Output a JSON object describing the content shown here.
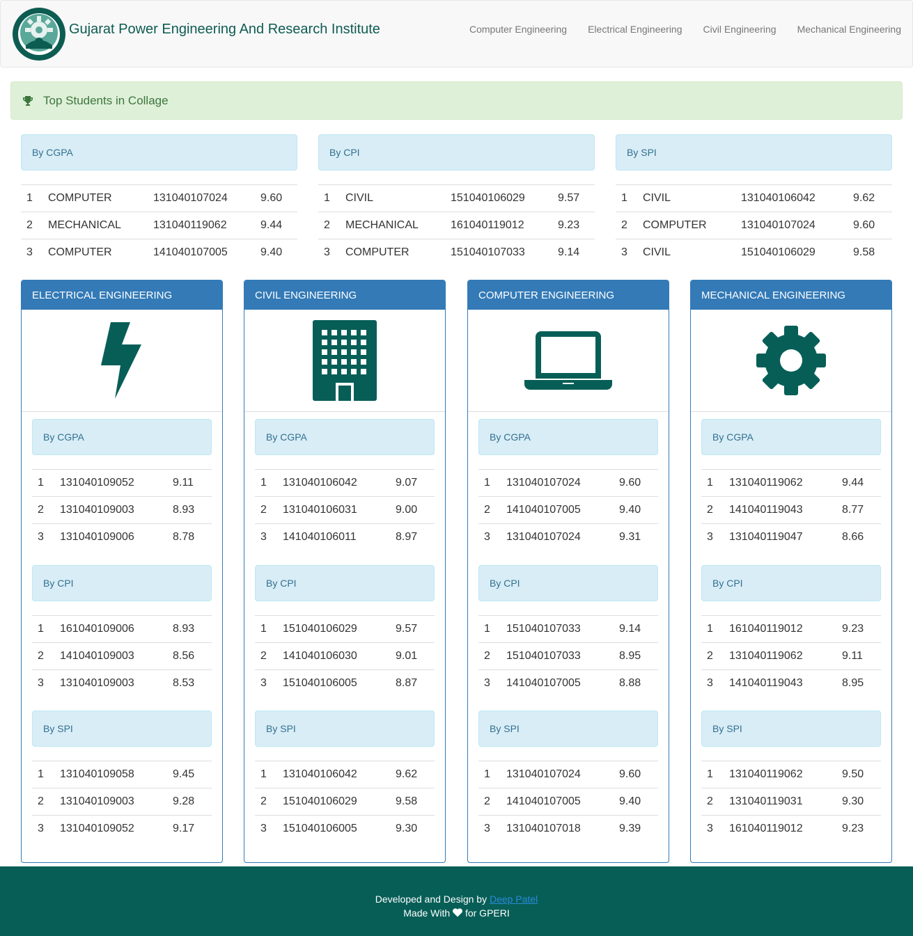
{
  "navbar": {
    "brand": "Gujarat Power Engineering And Research Institute",
    "links": [
      "Computer Engineering",
      "Electrical Engineering",
      "Civil Engineering",
      "Mechanical Engineering"
    ]
  },
  "alert": {
    "text": "Top Students in Collage",
    "icon": "trophy-icon"
  },
  "top": [
    {
      "heading": "By CGPA",
      "rows": [
        [
          "1",
          "COMPUTER",
          "131040107024",
          "9.60"
        ],
        [
          "2",
          "MECHANICAL",
          "131040119062",
          "9.44"
        ],
        [
          "3",
          "COMPUTER",
          "141040107005",
          "9.40"
        ]
      ]
    },
    {
      "heading": "By CPI",
      "rows": [
        [
          "1",
          "CIVIL",
          "151040106029",
          "9.57"
        ],
        [
          "2",
          "MECHANICAL",
          "161040119012",
          "9.23"
        ],
        [
          "3",
          "COMPUTER",
          "151040107033",
          "9.14"
        ]
      ]
    },
    {
      "heading": "By SPI",
      "rows": [
        [
          "1",
          "CIVIL",
          "131040106042",
          "9.62"
        ],
        [
          "2",
          "COMPUTER",
          "131040107024",
          "9.60"
        ],
        [
          "3",
          "CIVIL",
          "151040106029",
          "9.58"
        ]
      ]
    }
  ],
  "departments": [
    {
      "title": "ELECTRICAL ENGINEERING",
      "icon": "bolt-icon",
      "sections": [
        {
          "heading": "By CGPA",
          "rows": [
            [
              "1",
              "131040109052",
              "9.11"
            ],
            [
              "2",
              "131040109003",
              "8.93"
            ],
            [
              "3",
              "131040109006",
              "8.78"
            ]
          ]
        },
        {
          "heading": "By CPI",
          "rows": [
            [
              "1",
              "161040109006",
              "8.93"
            ],
            [
              "2",
              "141040109003",
              "8.56"
            ],
            [
              "3",
              "131040109003",
              "8.53"
            ]
          ]
        },
        {
          "heading": "By SPI",
          "rows": [
            [
              "1",
              "131040109058",
              "9.45"
            ],
            [
              "2",
              "131040109003",
              "9.28"
            ],
            [
              "3",
              "131040109052",
              "9.17"
            ]
          ]
        }
      ]
    },
    {
      "title": "CIVIL ENGINEERING",
      "icon": "building-icon",
      "sections": [
        {
          "heading": "By CGPA",
          "rows": [
            [
              "1",
              "131040106042",
              "9.07"
            ],
            [
              "2",
              "131040106031",
              "9.00"
            ],
            [
              "3",
              "141040106011",
              "8.97"
            ]
          ]
        },
        {
          "heading": "By CPI",
          "rows": [
            [
              "1",
              "151040106029",
              "9.57"
            ],
            [
              "2",
              "141040106030",
              "9.01"
            ],
            [
              "3",
              "151040106005",
              "8.87"
            ]
          ]
        },
        {
          "heading": "By SPI",
          "rows": [
            [
              "1",
              "131040106042",
              "9.62"
            ],
            [
              "2",
              "151040106029",
              "9.58"
            ],
            [
              "3",
              "151040106005",
              "9.30"
            ]
          ]
        }
      ]
    },
    {
      "title": "COMPUTER ENGINEERING",
      "icon": "laptop-icon",
      "sections": [
        {
          "heading": "By CGPA",
          "rows": [
            [
              "1",
              "131040107024",
              "9.60"
            ],
            [
              "2",
              "141040107005",
              "9.40"
            ],
            [
              "3",
              "131040107024",
              "9.31"
            ]
          ]
        },
        {
          "heading": "By CPI",
          "rows": [
            [
              "1",
              "151040107033",
              "9.14"
            ],
            [
              "2",
              "151040107033",
              "8.95"
            ],
            [
              "3",
              "141040107005",
              "8.88"
            ]
          ]
        },
        {
          "heading": "By SPI",
          "rows": [
            [
              "1",
              "131040107024",
              "9.60"
            ],
            [
              "2",
              "141040107005",
              "9.40"
            ],
            [
              "3",
              "131040107018",
              "9.39"
            ]
          ]
        }
      ]
    },
    {
      "title": "MECHANICAL ENGINEERING",
      "icon": "gear-icon",
      "sections": [
        {
          "heading": "By CGPA",
          "rows": [
            [
              "1",
              "131040119062",
              "9.44"
            ],
            [
              "2",
              "141040119043",
              "8.77"
            ],
            [
              "3",
              "131040119047",
              "8.66"
            ]
          ]
        },
        {
          "heading": "By CPI",
          "rows": [
            [
              "1",
              "161040119012",
              "9.23"
            ],
            [
              "2",
              "131040119062",
              "9.11"
            ],
            [
              "3",
              "141040119043",
              "8.95"
            ]
          ]
        },
        {
          "heading": "By SPI",
          "rows": [
            [
              "1",
              "131040119062",
              "9.50"
            ],
            [
              "2",
              "131040119031",
              "9.30"
            ],
            [
              "3",
              "161040119012",
              "9.23"
            ]
          ]
        }
      ]
    }
  ],
  "footer": {
    "line1_prefix": "Developed and Design by ",
    "author": "Deep Patel",
    "line2_prefix": "Made With ",
    "line2_suffix": " for GPERI",
    "heart_icon": "heart-icon"
  },
  "colors": {
    "brand": "#0d5c52",
    "icon": "#075e57",
    "panel_primary": "#337ab7",
    "footer": "#075e57"
  }
}
